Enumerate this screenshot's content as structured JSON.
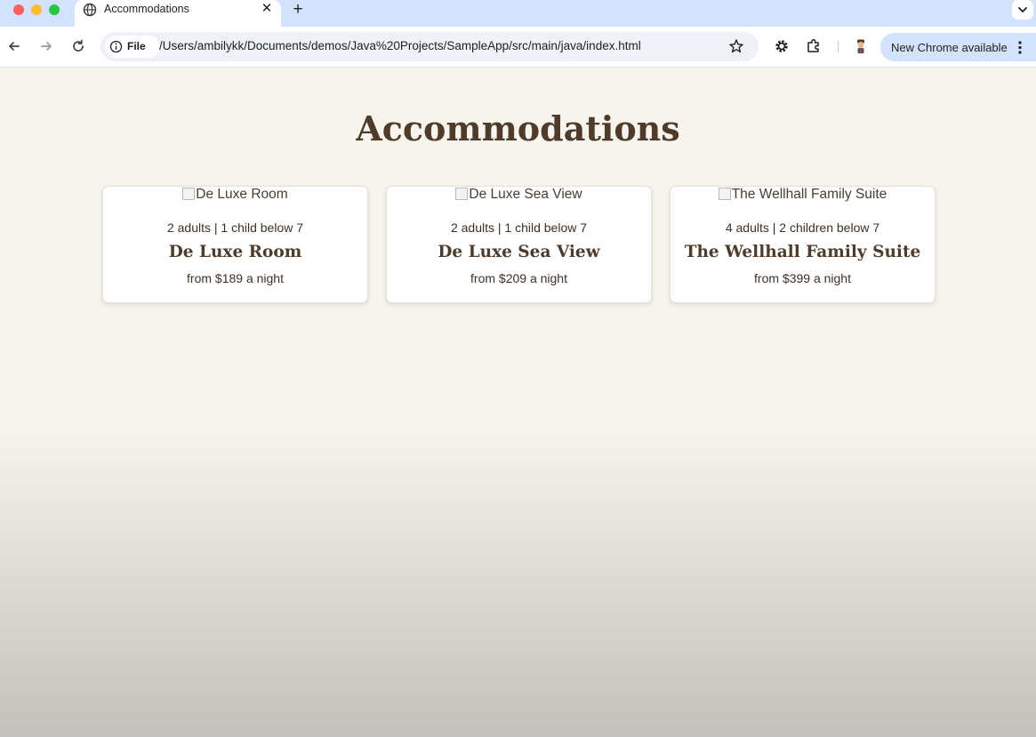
{
  "browser": {
    "tab": {
      "title": "Accommodations",
      "close_glyph": "✕"
    },
    "new_tab_glyph": "+",
    "omnibox": {
      "chip_label": "File",
      "url": "/Users/ambilykk/Documents/demos/Java%20Projects/SampleApp/src/main/java/index.html"
    },
    "update_pill": {
      "label": "New Chrome available"
    }
  },
  "page": {
    "title": "Accommodations",
    "rooms": [
      {
        "image_alt": "De Luxe Room",
        "occupancy": "2 adults | 1 child below 7",
        "name": "De Luxe Room",
        "price": "from $189 a night"
      },
      {
        "image_alt": "De Luxe Sea View",
        "occupancy": "2 adults | 1 child below 7",
        "name": "De Luxe Sea View",
        "price": "from $209 a night"
      },
      {
        "image_alt": "The Wellhall Family Suite",
        "occupancy": "4 adults | 2 children below 7",
        "name": "The Wellhall Family Suite",
        "price": "from $399 a night"
      }
    ]
  },
  "icons": {
    "tab_favicon": "globe-icon",
    "back": "arrow-left-icon",
    "forward": "arrow-right-icon",
    "reload": "reload-icon",
    "site_info": "info-icon",
    "bookmark": "star-icon",
    "extension_gear": "gear-icon",
    "extensions": "puzzle-icon",
    "profile": "avatar-icon",
    "menu": "kebab-menu-icon",
    "tab_search": "chevron-down-icon"
  },
  "colors": {
    "tab_strip": "#d3e3fd",
    "page_background": "#f7f4ee",
    "heading": "#4e3b2a",
    "body_text": "#3f3024"
  }
}
